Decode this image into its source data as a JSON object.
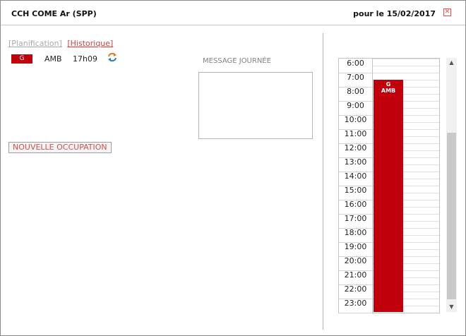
{
  "header": {
    "title": "CCH COME Ar (SPP)",
    "date": "pour le 15/02/2017",
    "close_glyph": "✕"
  },
  "links": {
    "planification": "[Planification]",
    "historique": "[Historique]"
  },
  "entry": {
    "badge": "G",
    "code": "AMB",
    "time": "17h09",
    "badge_color": "#c0000b"
  },
  "message": {
    "label": "MESSAGE JOURNÉE"
  },
  "actions": {
    "new_occupation": "NOUVELLE OCCUPATION"
  },
  "calendar": {
    "hours": [
      "6:00",
      "7:00",
      "8:00",
      "9:00",
      "10:00",
      "11:00",
      "12:00",
      "13:00",
      "14:00",
      "15:00",
      "16:00",
      "17:00",
      "18:00",
      "19:00",
      "20:00",
      "21:00",
      "22:00",
      "23:00"
    ],
    "event": {
      "line1": "G",
      "line2": "AMB",
      "start": "7:00",
      "end": "23:00+",
      "color": "#c0000b"
    }
  },
  "scrollbar": {
    "up_glyph": "▲",
    "down_glyph": "▼"
  }
}
